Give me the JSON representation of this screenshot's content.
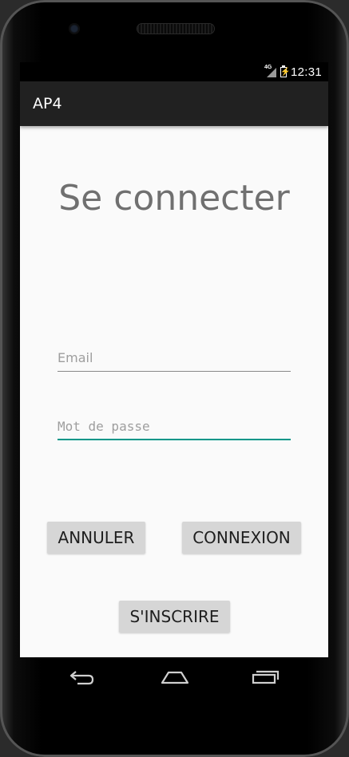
{
  "status_bar": {
    "network": "4G",
    "time": "12:31"
  },
  "app_bar": {
    "title": "AP4"
  },
  "login": {
    "title": "Se connecter",
    "email": {
      "placeholder": "Email",
      "value": ""
    },
    "password": {
      "placeholder": "Mot de passe",
      "value": ""
    },
    "cancel_label": "ANNULER",
    "connect_label": "CONNEXION",
    "signup_label": "S'INSCRIRE"
  },
  "nav_bar": {
    "icons": [
      "back-icon",
      "home-icon",
      "recents-icon"
    ]
  },
  "colors": {
    "accent": "#009688",
    "app_bar": "#212121",
    "button": "#d6d6d6",
    "title_text": "#707070"
  }
}
